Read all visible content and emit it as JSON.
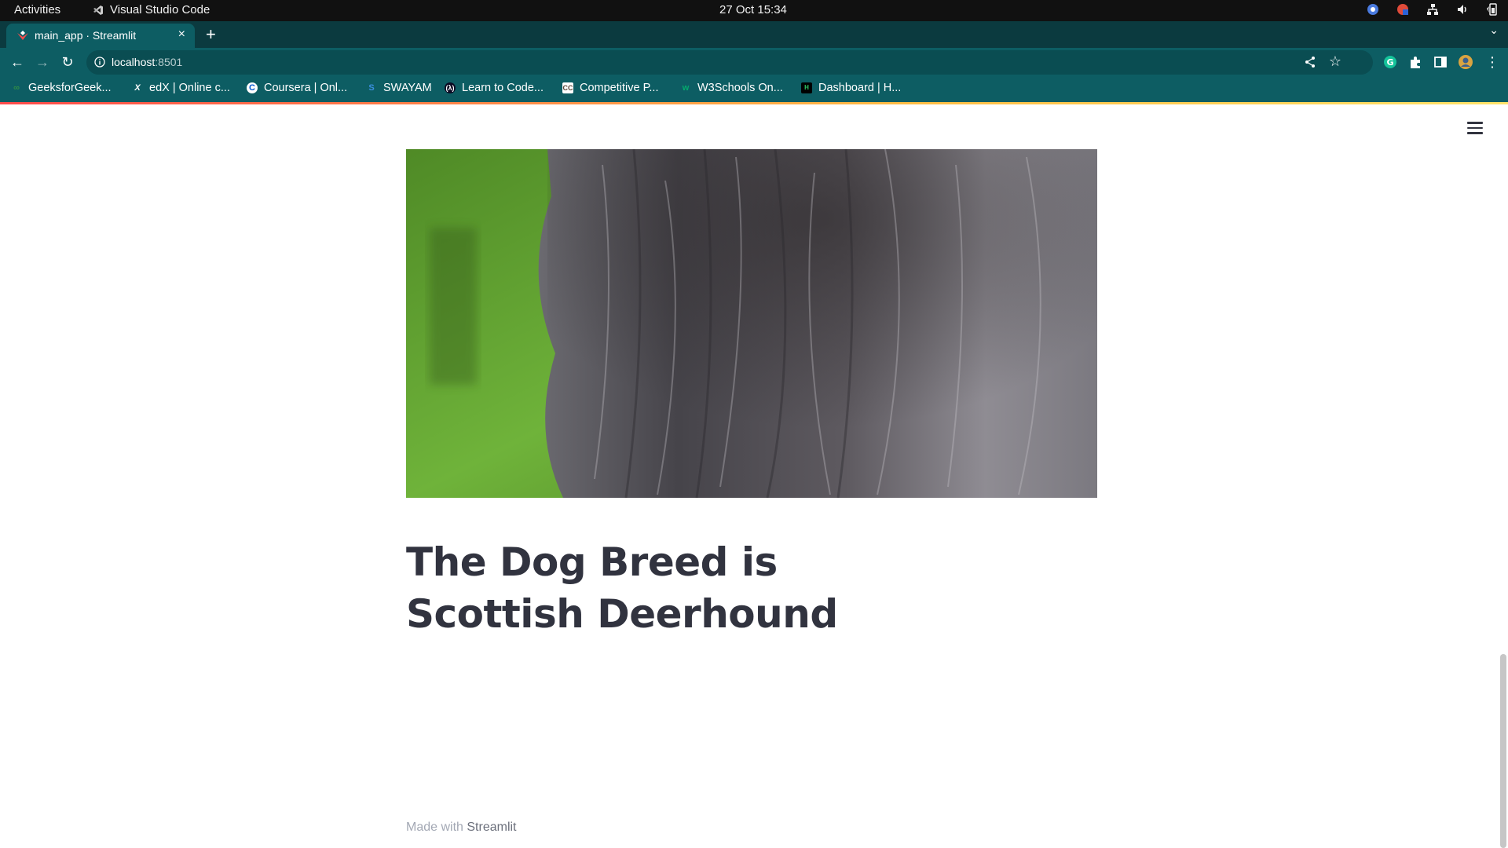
{
  "system_bar": {
    "activities": "Activities",
    "active_app": "Visual Studio Code",
    "clock": "27 Oct  15:34"
  },
  "browser": {
    "tab": {
      "title": "main_app · Streamlit",
      "close": "×"
    },
    "new_tab": "+",
    "address": {
      "host": "localhost",
      "port": ":8501"
    },
    "bookmarks": [
      {
        "label": "GeeksforGeek...",
        "icon": "gfg-icon"
      },
      {
        "label": "edX | Online c...",
        "icon": "edx-icon"
      },
      {
        "label": "Coursera | Onl...",
        "icon": "coursera-icon"
      },
      {
        "label": "SWAYAM",
        "icon": "swayam-icon"
      },
      {
        "label": "Learn to Code...",
        "icon": "freecodecamp-icon"
      },
      {
        "label": "Competitive P...",
        "icon": "codechef-icon"
      },
      {
        "label": "W3Schools On...",
        "icon": "w3schools-icon"
      },
      {
        "label": "Dashboard | H...",
        "icon": "hackerrank-icon"
      }
    ]
  },
  "app": {
    "result_title": "The Dog Breed is Scottish Deerhound",
    "footer": {
      "prefix": "Made with ",
      "brand": "Streamlit"
    }
  },
  "colors": {
    "tab_strip": "#0b3a3f",
    "toolbar": "#0d5d63",
    "heading": "#31333f",
    "streamlit_accent": "#ff4b4b"
  }
}
